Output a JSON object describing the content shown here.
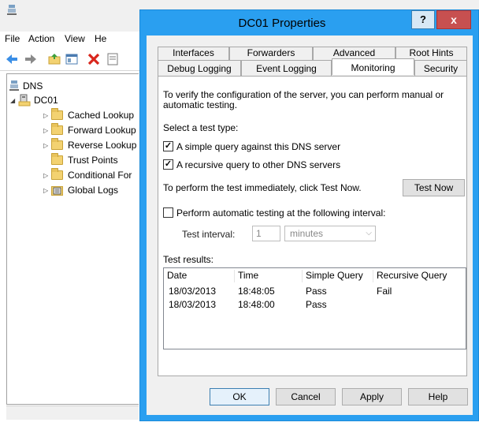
{
  "background_window": {
    "menu": [
      "File",
      "Action",
      "View",
      "He"
    ],
    "tree": {
      "root": "DNS",
      "server": "DC01",
      "children": [
        "Cached Lookup",
        "Forward Lookup",
        "Reverse Lookup",
        "Trust Points",
        "Conditional For",
        "Global Logs"
      ]
    }
  },
  "dialog": {
    "title": "DC01 Properties",
    "help_label": "?",
    "close_label": "x",
    "tabs_row1": [
      "Interfaces",
      "Forwarders",
      "Advanced",
      "Root Hints"
    ],
    "tabs_row2": [
      "Debug Logging",
      "Event Logging",
      "Monitoring",
      "Security"
    ],
    "active_tab": "Monitoring",
    "intro_line1": "To verify the configuration of the server, you can perform manual or",
    "intro_line2": "automatic testing.",
    "select_test_type": "Select a test type:",
    "check_simple": {
      "label": "A simple query against this DNS server",
      "checked": true
    },
    "check_recursive": {
      "label": "A recursive query to other DNS servers",
      "checked": true
    },
    "test_now_prompt": "To perform the test immediately, click Test Now.",
    "test_now_button": "Test Now",
    "check_automatic": {
      "label": "Perform automatic testing at the following interval:",
      "checked": false
    },
    "test_interval_label": "Test interval:",
    "test_interval_value": "1",
    "test_interval_unit": "minutes",
    "test_results_label": "Test results:",
    "results_columns": [
      "Date",
      "Time",
      "Simple Query",
      "Recursive Query"
    ],
    "results_rows": [
      [
        "18/03/2013",
        "18:48:05",
        "Pass",
        "Fail"
      ],
      [
        "18/03/2013",
        "18:48:00",
        "Pass",
        ""
      ]
    ],
    "buttons": {
      "ok": "OK",
      "cancel": "Cancel",
      "apply": "Apply",
      "help": "Help"
    }
  }
}
